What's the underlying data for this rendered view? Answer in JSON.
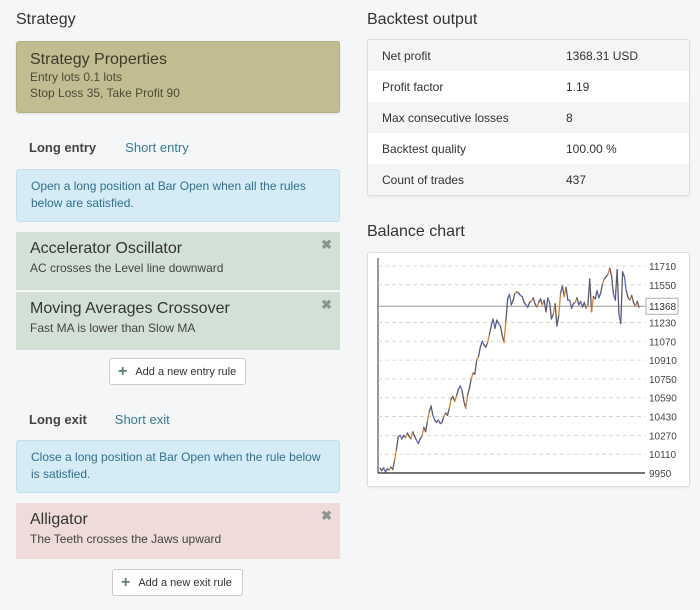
{
  "strategy": {
    "title": "Strategy",
    "properties": {
      "title": "Strategy Properties",
      "lines": [
        "Entry lots 0.1 lots",
        "Stop Loss 35, Take Profit 90"
      ]
    },
    "entry_tabs": [
      {
        "label": "Long entry",
        "active": true
      },
      {
        "label": "Short entry",
        "active": false
      }
    ],
    "entry_info": "Open a long position at Bar Open when all the rules below are satisfied.",
    "entry_rules": [
      {
        "title": "Accelerator Oscillator",
        "desc": "AC crosses the Level line downward",
        "remove_icon": "close-icon"
      },
      {
        "title": "Moving Averages Crossover",
        "desc": "Fast MA is lower than Slow MA",
        "remove_icon": "close-icon"
      }
    ],
    "add_entry_label": "Add a new entry rule",
    "exit_tabs": [
      {
        "label": "Long exit",
        "active": true
      },
      {
        "label": "Short exit",
        "active": false
      }
    ],
    "exit_info": "Close a long position at Bar Open when the rule below is satisfied.",
    "exit_rules": [
      {
        "title": "Alligator",
        "desc": "The Teeth crosses the Jaws upward",
        "remove_icon": "close-icon"
      }
    ],
    "add_exit_label": "Add a new exit rule",
    "plus_icon": "plus-icon"
  },
  "backtest": {
    "title": "Backtest output",
    "rows": [
      {
        "label": "Net profit",
        "value": "1368.31 USD"
      },
      {
        "label": "Profit factor",
        "value": "1.19"
      },
      {
        "label": "Max consecutive losses",
        "value": "8"
      },
      {
        "label": "Backtest quality",
        "value": "100.00 %"
      },
      {
        "label": "Count of trades",
        "value": "437"
      }
    ]
  },
  "balance": {
    "title": "Balance chart",
    "colors": {
      "line": "#5a5a6e",
      "up": "#d9822b",
      "down": "#5b6ec9",
      "grid": "#cccccc",
      "current": "#999999"
    },
    "chart_data": {
      "type": "line",
      "title": "Balance chart",
      "ylim": [
        9950,
        11710
      ],
      "yticks": [
        11710,
        11550,
        11230,
        11070,
        10910,
        10750,
        10590,
        10430,
        10270,
        10110,
        9950
      ],
      "current_value": 11368,
      "current_label": "11368",
      "x_count": 437,
      "series": [
        {
          "name": "Balance",
          "values": [
            9990,
            9970,
            9995,
            9960,
            9985,
            9975,
            10000,
            9980,
            10060,
            10150,
            10260,
            10270,
            10240,
            10270,
            10250,
            10290,
            10260,
            10240,
            10300,
            10260,
            10230,
            10200,
            10240,
            10260,
            10340,
            10300,
            10390,
            10470,
            10520,
            10440,
            10400,
            10380,
            10400,
            10370,
            10380,
            10430,
            10460,
            10440,
            10500,
            10580,
            10600,
            10560,
            10610,
            10660,
            10690,
            10650,
            10560,
            10500,
            10610,
            10670,
            10750,
            10800,
            10790,
            10910,
            10940,
            11020,
            11070,
            11040,
            11020,
            11060,
            11130,
            11200,
            11260,
            11180,
            11250,
            11220,
            11200,
            11120,
            11060,
            11240,
            11430,
            11470,
            11380,
            11420,
            11480,
            11490,
            11480,
            11460,
            11450,
            11400,
            11380,
            11360,
            11400,
            11410,
            11440,
            11390,
            11360,
            11400,
            11430,
            11380,
            11420,
            11320,
            11440,
            11400,
            11260,
            11300,
            11390,
            11200,
            11290,
            11480,
            11540,
            11450,
            11530,
            11420,
            11420,
            11350,
            11390,
            11400,
            11440,
            11380,
            11410,
            11360,
            11400,
            11350,
            11380,
            11600,
            11320,
            11450,
            11430,
            11500,
            11440,
            11480,
            11560,
            11600,
            11620,
            11640,
            11690,
            11620,
            11470,
            11420,
            11680,
            11300,
            11220,
            11660,
            11620,
            11500,
            11440,
            11420,
            11460,
            11400,
            11370,
            11410,
            11360
          ]
        }
      ]
    }
  }
}
